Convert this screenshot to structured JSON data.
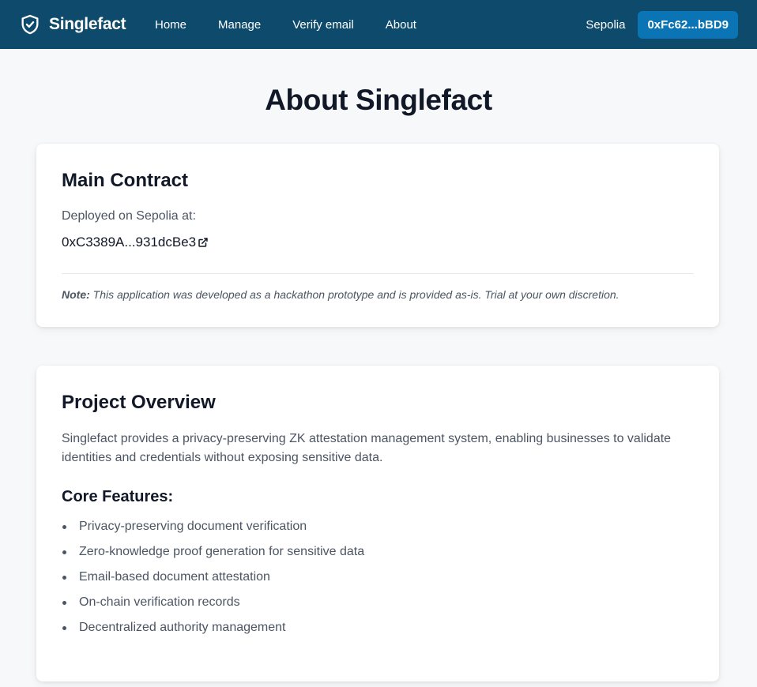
{
  "nav": {
    "brand": "Singlefact",
    "links": [
      "Home",
      "Manage",
      "Verify email",
      "About"
    ],
    "network": "Sepolia",
    "wallet": "0xFc62...bBD9"
  },
  "page": {
    "title": "About Singlefact"
  },
  "contract": {
    "heading": "Main Contract",
    "deployed_label": "Deployed on Sepolia at:",
    "address": "0xC3389A...931dcBe3",
    "note_label": "Note:",
    "note_text": "This application was developed as a hackathon prototype and is provided as-is. Trial at your own discretion."
  },
  "overview": {
    "heading": "Project Overview",
    "description": "Singlefact provides a privacy-preserving ZK attestation management system, enabling businesses to validate identities and credentials without exposing sensitive data.",
    "features_heading": "Core Features:",
    "features": [
      "Privacy-preserving document verification",
      "Zero-knowledge proof generation for sensitive data",
      "Email-based document attestation",
      "On-chain verification records",
      "Decentralized authority management"
    ]
  },
  "colors": {
    "navbar": "#0d4a6b",
    "wallet_button": "#0b74b5",
    "background": "#f7f8fa"
  }
}
